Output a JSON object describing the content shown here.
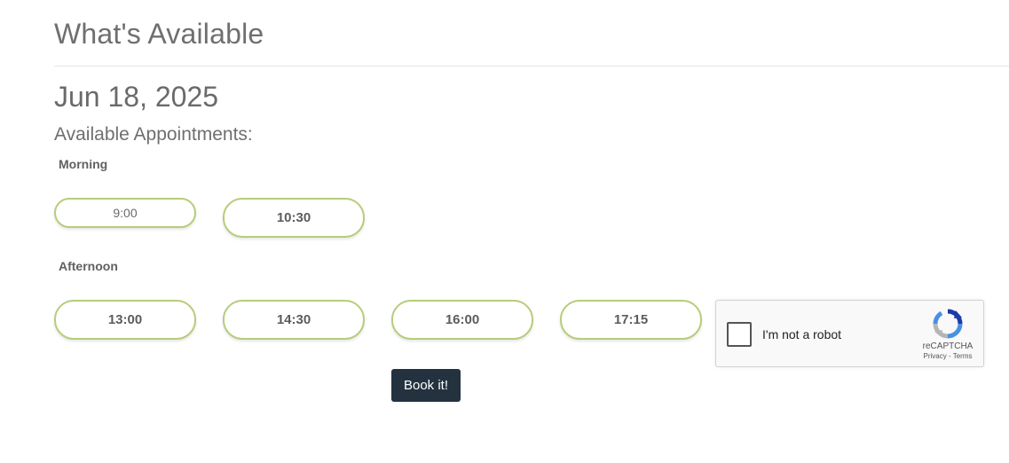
{
  "header": {
    "title": "What's Available"
  },
  "schedule": {
    "date": "Jun 18, 2025",
    "subtitle": "Available Appointments:",
    "morning": {
      "label": "Morning",
      "slots": [
        "9:00",
        "10:30"
      ]
    },
    "afternoon": {
      "label": "Afternoon",
      "slots": [
        "13:00",
        "14:30",
        "16:00",
        "17:15"
      ]
    }
  },
  "recaptcha": {
    "label": "I'm not a robot",
    "brand": "reCAPTCHA",
    "privacy": "Privacy",
    "separator": " - ",
    "terms": "Terms",
    "checked": false,
    "logo_icon": "recaptcha-logo-icon"
  },
  "actions": {
    "book_label": "Book it!"
  },
  "colors": {
    "slot_border": "#b7cc7a",
    "button_bg": "#243240",
    "text": "#6b6b6b"
  }
}
